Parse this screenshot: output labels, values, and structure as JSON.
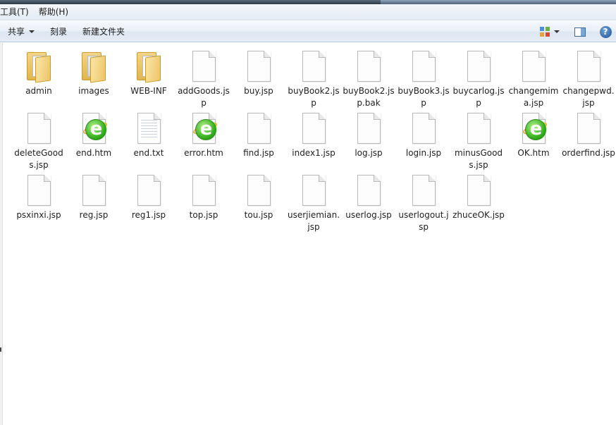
{
  "menubar": {
    "items": [
      "工具(T)",
      "帮助(H)"
    ]
  },
  "toolbar": {
    "share_label": "共享",
    "burn_label": "刻录",
    "new_folder_label": "新建文件夹"
  },
  "files": [
    {
      "name": "admin",
      "type": "folder"
    },
    {
      "name": "images",
      "type": "folder"
    },
    {
      "name": "WEB-INF",
      "type": "folder"
    },
    {
      "name": "addGoods.jsp",
      "type": "doc"
    },
    {
      "name": "buy.jsp",
      "type": "doc"
    },
    {
      "name": "buyBook2.jsp",
      "type": "doc"
    },
    {
      "name": "buyBook2.jsp.bak",
      "type": "doc"
    },
    {
      "name": "buyBook3.jsp",
      "type": "doc"
    },
    {
      "name": "buycarlog.jsp",
      "type": "doc"
    },
    {
      "name": "changemima.jsp",
      "type": "doc"
    },
    {
      "name": "changepwd.jsp",
      "type": "doc"
    },
    {
      "name": "deleteGoods.jsp",
      "type": "doc"
    },
    {
      "name": "end.htm",
      "type": "html"
    },
    {
      "name": "end.txt",
      "type": "txt"
    },
    {
      "name": "error.htm",
      "type": "html"
    },
    {
      "name": "find.jsp",
      "type": "doc"
    },
    {
      "name": "index1.jsp",
      "type": "doc"
    },
    {
      "name": "log.jsp",
      "type": "doc"
    },
    {
      "name": "login.jsp",
      "type": "doc"
    },
    {
      "name": "minusGoods.jsp",
      "type": "doc"
    },
    {
      "name": "OK.htm",
      "type": "html"
    },
    {
      "name": "orderfind.jsp",
      "type": "doc"
    },
    {
      "name": "psxinxi.jsp",
      "type": "doc"
    },
    {
      "name": "reg.jsp",
      "type": "doc"
    },
    {
      "name": "reg1.jsp",
      "type": "doc"
    },
    {
      "name": "top.jsp",
      "type": "doc"
    },
    {
      "name": "tou.jsp",
      "type": "doc"
    },
    {
      "name": "userjiemian.jsp",
      "type": "doc"
    },
    {
      "name": "userlog.jsp",
      "type": "doc"
    },
    {
      "name": "userlogout.jsp",
      "type": "doc"
    },
    {
      "name": "zhuceOK.jsp",
      "type": "doc"
    }
  ]
}
